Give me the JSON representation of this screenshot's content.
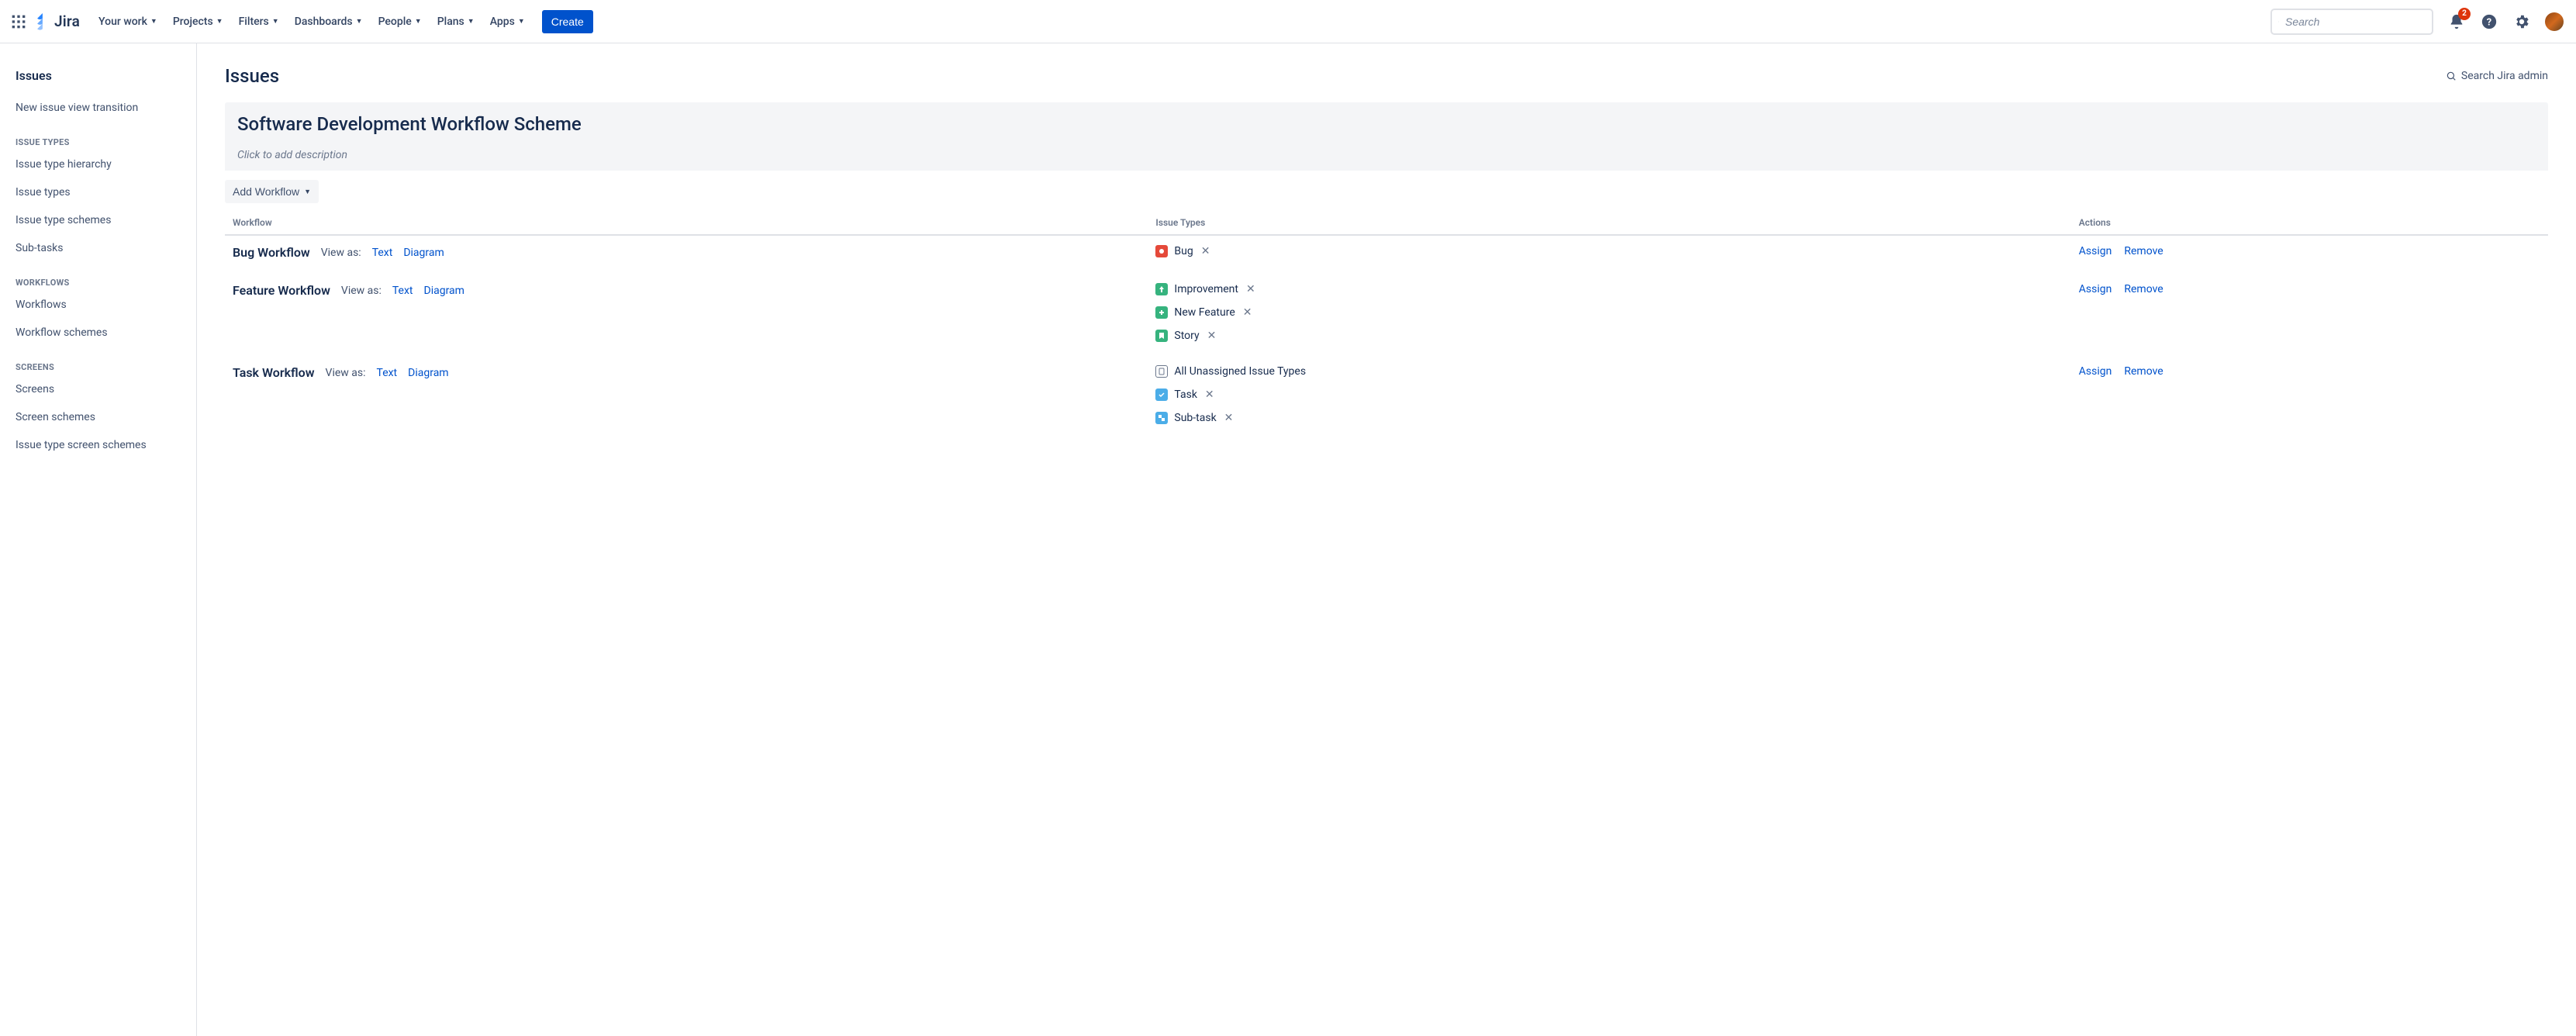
{
  "topnav": {
    "logo_text": "Jira",
    "items": [
      "Your work",
      "Projects",
      "Filters",
      "Dashboards",
      "People",
      "Plans",
      "Apps"
    ],
    "create_label": "Create",
    "search_placeholder": "Search",
    "notif_count": "2"
  },
  "sidebar": {
    "title": "Issues",
    "links_top": [
      "New issue view transition"
    ],
    "sections": [
      {
        "heading": "ISSUE TYPES",
        "links": [
          "Issue type hierarchy",
          "Issue types",
          "Issue type schemes",
          "Sub-tasks"
        ]
      },
      {
        "heading": "WORKFLOWS",
        "links": [
          "Workflows",
          "Workflow schemes"
        ]
      },
      {
        "heading": "SCREENS",
        "links": [
          "Screens",
          "Screen schemes",
          "Issue type screen schemes"
        ]
      }
    ]
  },
  "main": {
    "title": "Issues",
    "search_admin_label": "Search Jira admin",
    "scheme_title": "Software Development Workflow Scheme",
    "scheme_desc_placeholder": "Click to add description",
    "add_workflow_label": "Add Workflow",
    "columns": {
      "workflow": "Workflow",
      "issue_types": "Issue Types",
      "actions": "Actions"
    },
    "view_as_label": "View as:",
    "view_text": "Text",
    "view_diagram": "Diagram",
    "action_assign": "Assign",
    "action_remove": "Remove",
    "rows": [
      {
        "name": "Bug Workflow",
        "issue_types": [
          {
            "label": "Bug",
            "icon": "bug",
            "removable": true
          }
        ]
      },
      {
        "name": "Feature Workflow",
        "issue_types": [
          {
            "label": "Improvement",
            "icon": "improve",
            "removable": true
          },
          {
            "label": "New Feature",
            "icon": "feature",
            "removable": true
          },
          {
            "label": "Story",
            "icon": "story",
            "removable": true
          }
        ]
      },
      {
        "name": "Task Workflow",
        "issue_types": [
          {
            "label": "All Unassigned Issue Types",
            "icon": "unassigned",
            "removable": false
          },
          {
            "label": "Task",
            "icon": "task",
            "removable": true
          },
          {
            "label": "Sub-task",
            "icon": "subtask",
            "removable": true
          }
        ]
      }
    ]
  }
}
